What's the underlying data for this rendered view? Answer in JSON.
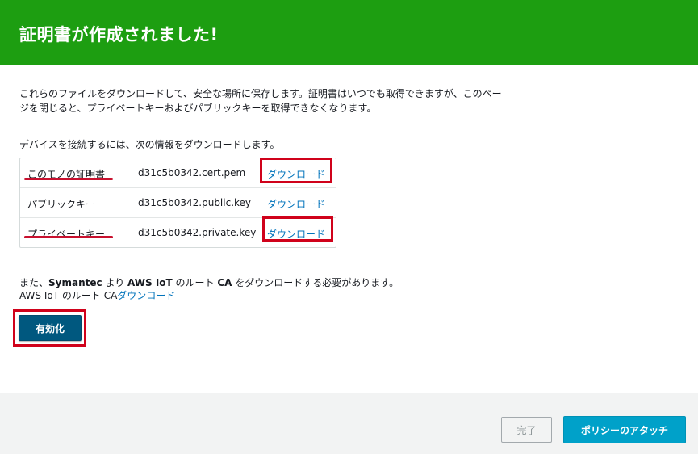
{
  "header": {
    "title": "証明書が作成されました!",
    "background": "#1d9e11"
  },
  "intro": {
    "line1": "これらのファイルをダウンロードして、安全な場所に保存します。証明書はいつでも取得できますが、このペー",
    "line2": "ジを閉じると、プライベートキーおよびパブリックキーを取得できなくなります。"
  },
  "devices_label": "デバイスを接続するには、次の情報をダウンロードします。",
  "certificates": [
    {
      "label": "このモノの証明書",
      "filename": "d31c5b0342.cert.pem",
      "download": "ダウンロード"
    },
    {
      "label": "パブリックキー",
      "filename": "d31c5b0342.public.key",
      "download": "ダウンロード"
    },
    {
      "label": "プライベートキー",
      "filename": "d31c5b0342.private.key",
      "download": "ダウンロード"
    }
  ],
  "root_ca": {
    "pre": "また、",
    "symantec": "Symantec",
    "mid1": " より ",
    "aws_iot": "AWS IoT",
    "mid2": " のルート ",
    "ca": "CA",
    "post": " をダウンロードする必要があります。",
    "link_prefix": "AWS IoT のルート CA",
    "link_label": "ダウンロード"
  },
  "buttons": {
    "activate": "有効化",
    "done": "完了",
    "attach_policy": "ポリシーのアタッチ"
  },
  "colors": {
    "link": "#0073bb",
    "annotation": "#d0021b",
    "primary_button": "#00a1c9",
    "activate_button": "#00587f"
  }
}
